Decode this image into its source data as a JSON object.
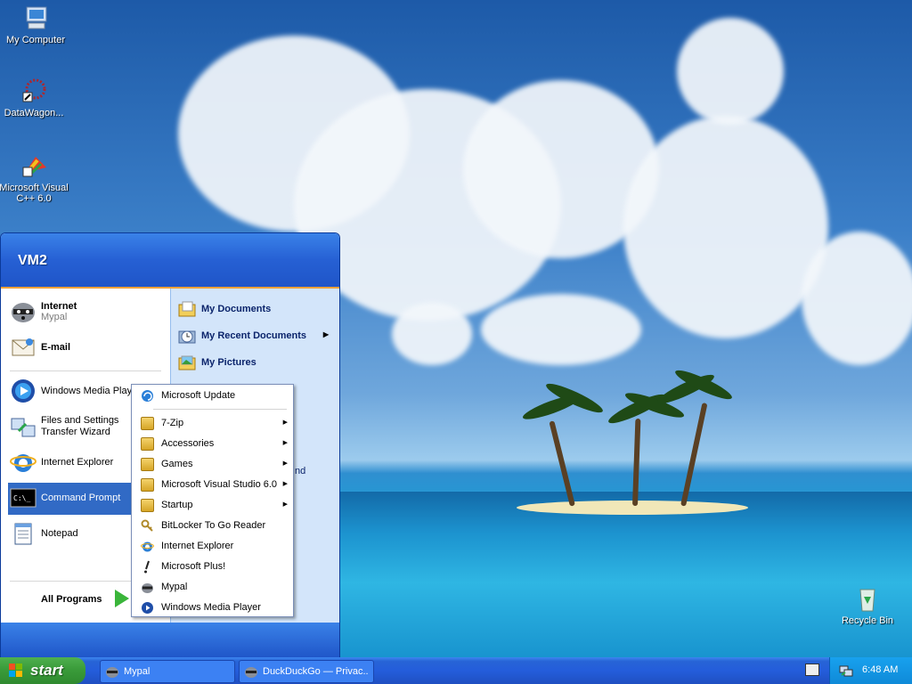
{
  "desktop": {
    "icons": [
      {
        "label": "My Computer",
        "icon": "my-computer-icon"
      },
      {
        "label": "DataWagon...",
        "icon": "datawagon-shortcut-icon"
      },
      {
        "label": "Microsoft Visual C++ 6.0",
        "icon": "visual-cpp-shortcut-icon"
      },
      {
        "label": "Recycle Bin",
        "icon": "recycle-bin-icon"
      }
    ]
  },
  "start_menu": {
    "user_name": "VM2",
    "pinned": [
      {
        "title": "Internet",
        "subtitle": "Mypal",
        "icon": "mypal-raccoon-icon"
      },
      {
        "title": "E-mail",
        "icon": "email-envelope-icon"
      }
    ],
    "recent": [
      {
        "label": "Windows Media Player",
        "icon": "media-player-icon"
      },
      {
        "label": "Files and Settings Transfer Wizard",
        "icon": "transfer-wizard-icon"
      },
      {
        "label": "Internet Explorer",
        "icon": "ie-icon"
      },
      {
        "label": "Command Prompt",
        "icon": "cmd-icon",
        "selected": true
      },
      {
        "label": "Notepad",
        "icon": "notepad-icon"
      }
    ],
    "all_programs_label": "All Programs",
    "right_items": [
      {
        "label": "My Documents",
        "icon": "my-documents-icon"
      },
      {
        "label": "My Recent Documents",
        "icon": "recent-documents-icon",
        "has_submenu": true
      },
      {
        "label": "My Pictures",
        "icon": "my-pictures-icon"
      }
    ],
    "right_partial_text": "nd"
  },
  "programs_submenu": {
    "items": [
      {
        "label": "Microsoft Update",
        "icon": "ms-update-icon"
      },
      {
        "label": "7-Zip",
        "icon": "folder-icon",
        "has_submenu": true
      },
      {
        "label": "Accessories",
        "icon": "folder-icon",
        "has_submenu": true
      },
      {
        "label": "Games",
        "icon": "folder-icon",
        "has_submenu": true
      },
      {
        "label": "Microsoft Visual Studio 6.0",
        "icon": "folder-icon",
        "has_submenu": true
      },
      {
        "label": "Startup",
        "icon": "folder-icon",
        "has_submenu": true
      },
      {
        "label": "BitLocker To Go Reader",
        "icon": "bitlocker-icon"
      },
      {
        "label": "Internet Explorer",
        "icon": "ie-icon"
      },
      {
        "label": "Microsoft Plus!",
        "icon": "ms-plus-icon"
      },
      {
        "label": "Mypal",
        "icon": "mypal-raccoon-icon"
      },
      {
        "label": "Windows Media Player",
        "icon": "media-player-icon"
      }
    ]
  },
  "taskbar": {
    "start_label": "start",
    "tasks": [
      {
        "label": "Mypal",
        "icon": "mypal-raccoon-icon"
      },
      {
        "label": "DuckDuckGo — Privac...",
        "icon": "mypal-raccoon-icon"
      }
    ],
    "clock": "6:48 AM"
  },
  "colors": {
    "taskbar_blue": "#245ddb",
    "start_green": "#3a9b3a",
    "menu_header_blue": "#2660d4",
    "selection_blue": "#316ac5",
    "right_pane_blue": "#d3e5fa"
  }
}
